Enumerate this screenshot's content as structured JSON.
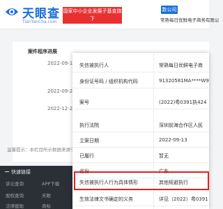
{
  "header": {
    "logo_text": "天眼查",
    "logo_url": "TianYanCha.com",
    "slogan_line1": "国家中小企业发展子基金旗下",
    "slogan_line2": "官方备案企业征信机构",
    "tag_label": "数公司",
    "company_name": "常熟每日优鲜电子商务有限公"
  },
  "background": {
    "section_title": "案件程序进展",
    "dates": [
      "2022-09-13",
      "2022-09-26",
      "2022-12-22"
    ],
    "notice": "温馨提示：本栏目所示数据来源于公开",
    "footer_title": "快速链接",
    "footer_items": [
      "诉讼查询",
      "股权查询",
      "法律援助",
      "APP下载",
      "天眼",
      "商标"
    ]
  },
  "modal": {
    "rows": [
      {
        "label": "失信被执行人",
        "value": "常熟每日优鲜电子商"
      },
      {
        "label": "身份证号码 / 组织机构代码",
        "value": "91320581MA****W9"
      },
      {
        "label": "案号",
        "value": "(2022)粤0391执424"
      },
      {
        "label": "执行法院",
        "value": "深圳前海合作区人民"
      },
      {
        "label": "立案日期",
        "value": "2022-09-13"
      },
      {
        "label": "已履行",
        "value": "暂无"
      },
      {
        "label": "省份",
        "value": "广东"
      },
      {
        "label": "失信被执行人行为具体情形",
        "value": "其他规避执行"
      },
      {
        "label": "生效法律文书确定的义务",
        "value": "详见（2022）粤0391"
      }
    ]
  },
  "colors": {
    "brand": "#1a6fd8",
    "highlight": "#e02020",
    "slogan_bg": "#e93030"
  }
}
